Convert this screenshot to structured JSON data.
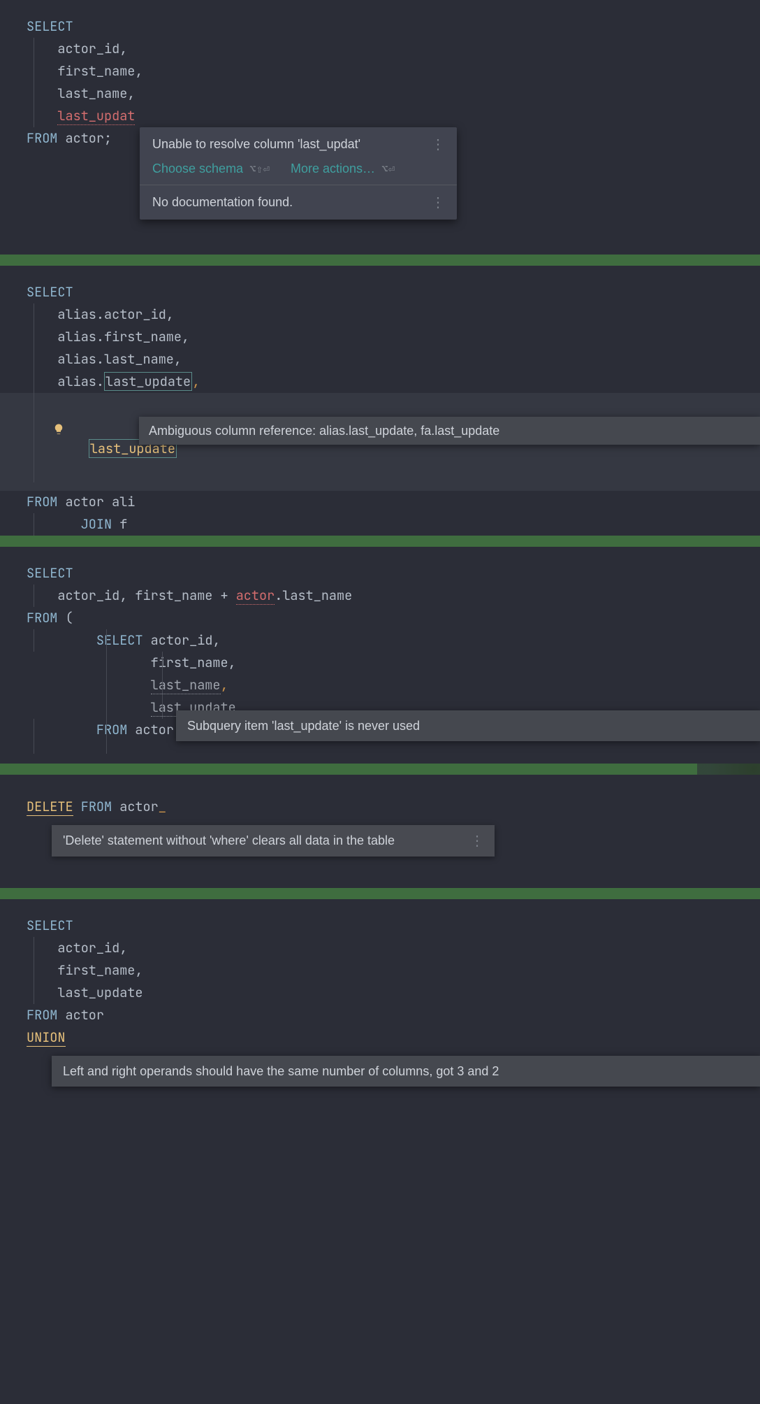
{
  "block1": {
    "l1": "SELECT",
    "l2": "    actor_id,",
    "l3": "    first_name,",
    "l4": "    last_name,",
    "l5_pre": "    ",
    "l5_err": "last_updat",
    "l6_kw": "FROM",
    "l6_rest": " actor;",
    "popup_title": "Unable to resolve column 'last_updat'",
    "popup_link1": "Choose schema",
    "popup_sc1": "⌥⇧⏎",
    "popup_link2": "More actions…",
    "popup_sc2": "⌥⏎",
    "popup_nodoc": "No documentation found."
  },
  "block2": {
    "l1": "SELECT",
    "l2": "    alias.actor_id,",
    "l3": "    alias.first_name,",
    "l4": "    alias.last_name,",
    "l5_pre": "    alias.",
    "l5_box": "last_update",
    "l5_post": ",",
    "l6_pre": "    ",
    "l6_warn": "last_update",
    "l7_kw": "FROM",
    "l7_rest": " actor ali",
    "l8_pre": "       ",
    "l8_kw": "JOIN",
    "l8_rest": " f",
    "tooltip": "Ambiguous column reference: alias.last_update, fa.last_update"
  },
  "block3": {
    "l1": "SELECT",
    "l2a": "    actor_id, first_name + ",
    "l2b": "actor",
    "l2c": ".last_name",
    "l3": "FROM",
    "l3b": " (",
    "l4_pre": "         ",
    "l4_kw": "SELECT",
    "l4_rest": " actor_id,",
    "l5": "                first_name,",
    "l6_pre": "                ",
    "l6_txt": "last_name",
    "l6_post": ",",
    "l7_pre": "                ",
    "l7_txt": "last_update",
    "l8_pre": "         ",
    "l8_kw": "FROM",
    "l8_rest": " actor",
    "tooltip": "Subquery item 'last_update' is never used"
  },
  "block4": {
    "l1_kw1": "DELETE",
    "l1_mid": " ",
    "l1_kw2": "FROM",
    "l1_rest": " actor",
    "tooltip": "'Delete' statement without 'where' clears all data in the table"
  },
  "block5": {
    "l1": "SELECT",
    "l2": "    actor_id,",
    "l3": "    first_name,",
    "l4": "    last_update",
    "l5_kw": "FROM",
    "l5_rest": " actor",
    "l6": "UNION",
    "tooltip": "Left and right operands should have the same number of columns, got 3 and 2"
  }
}
